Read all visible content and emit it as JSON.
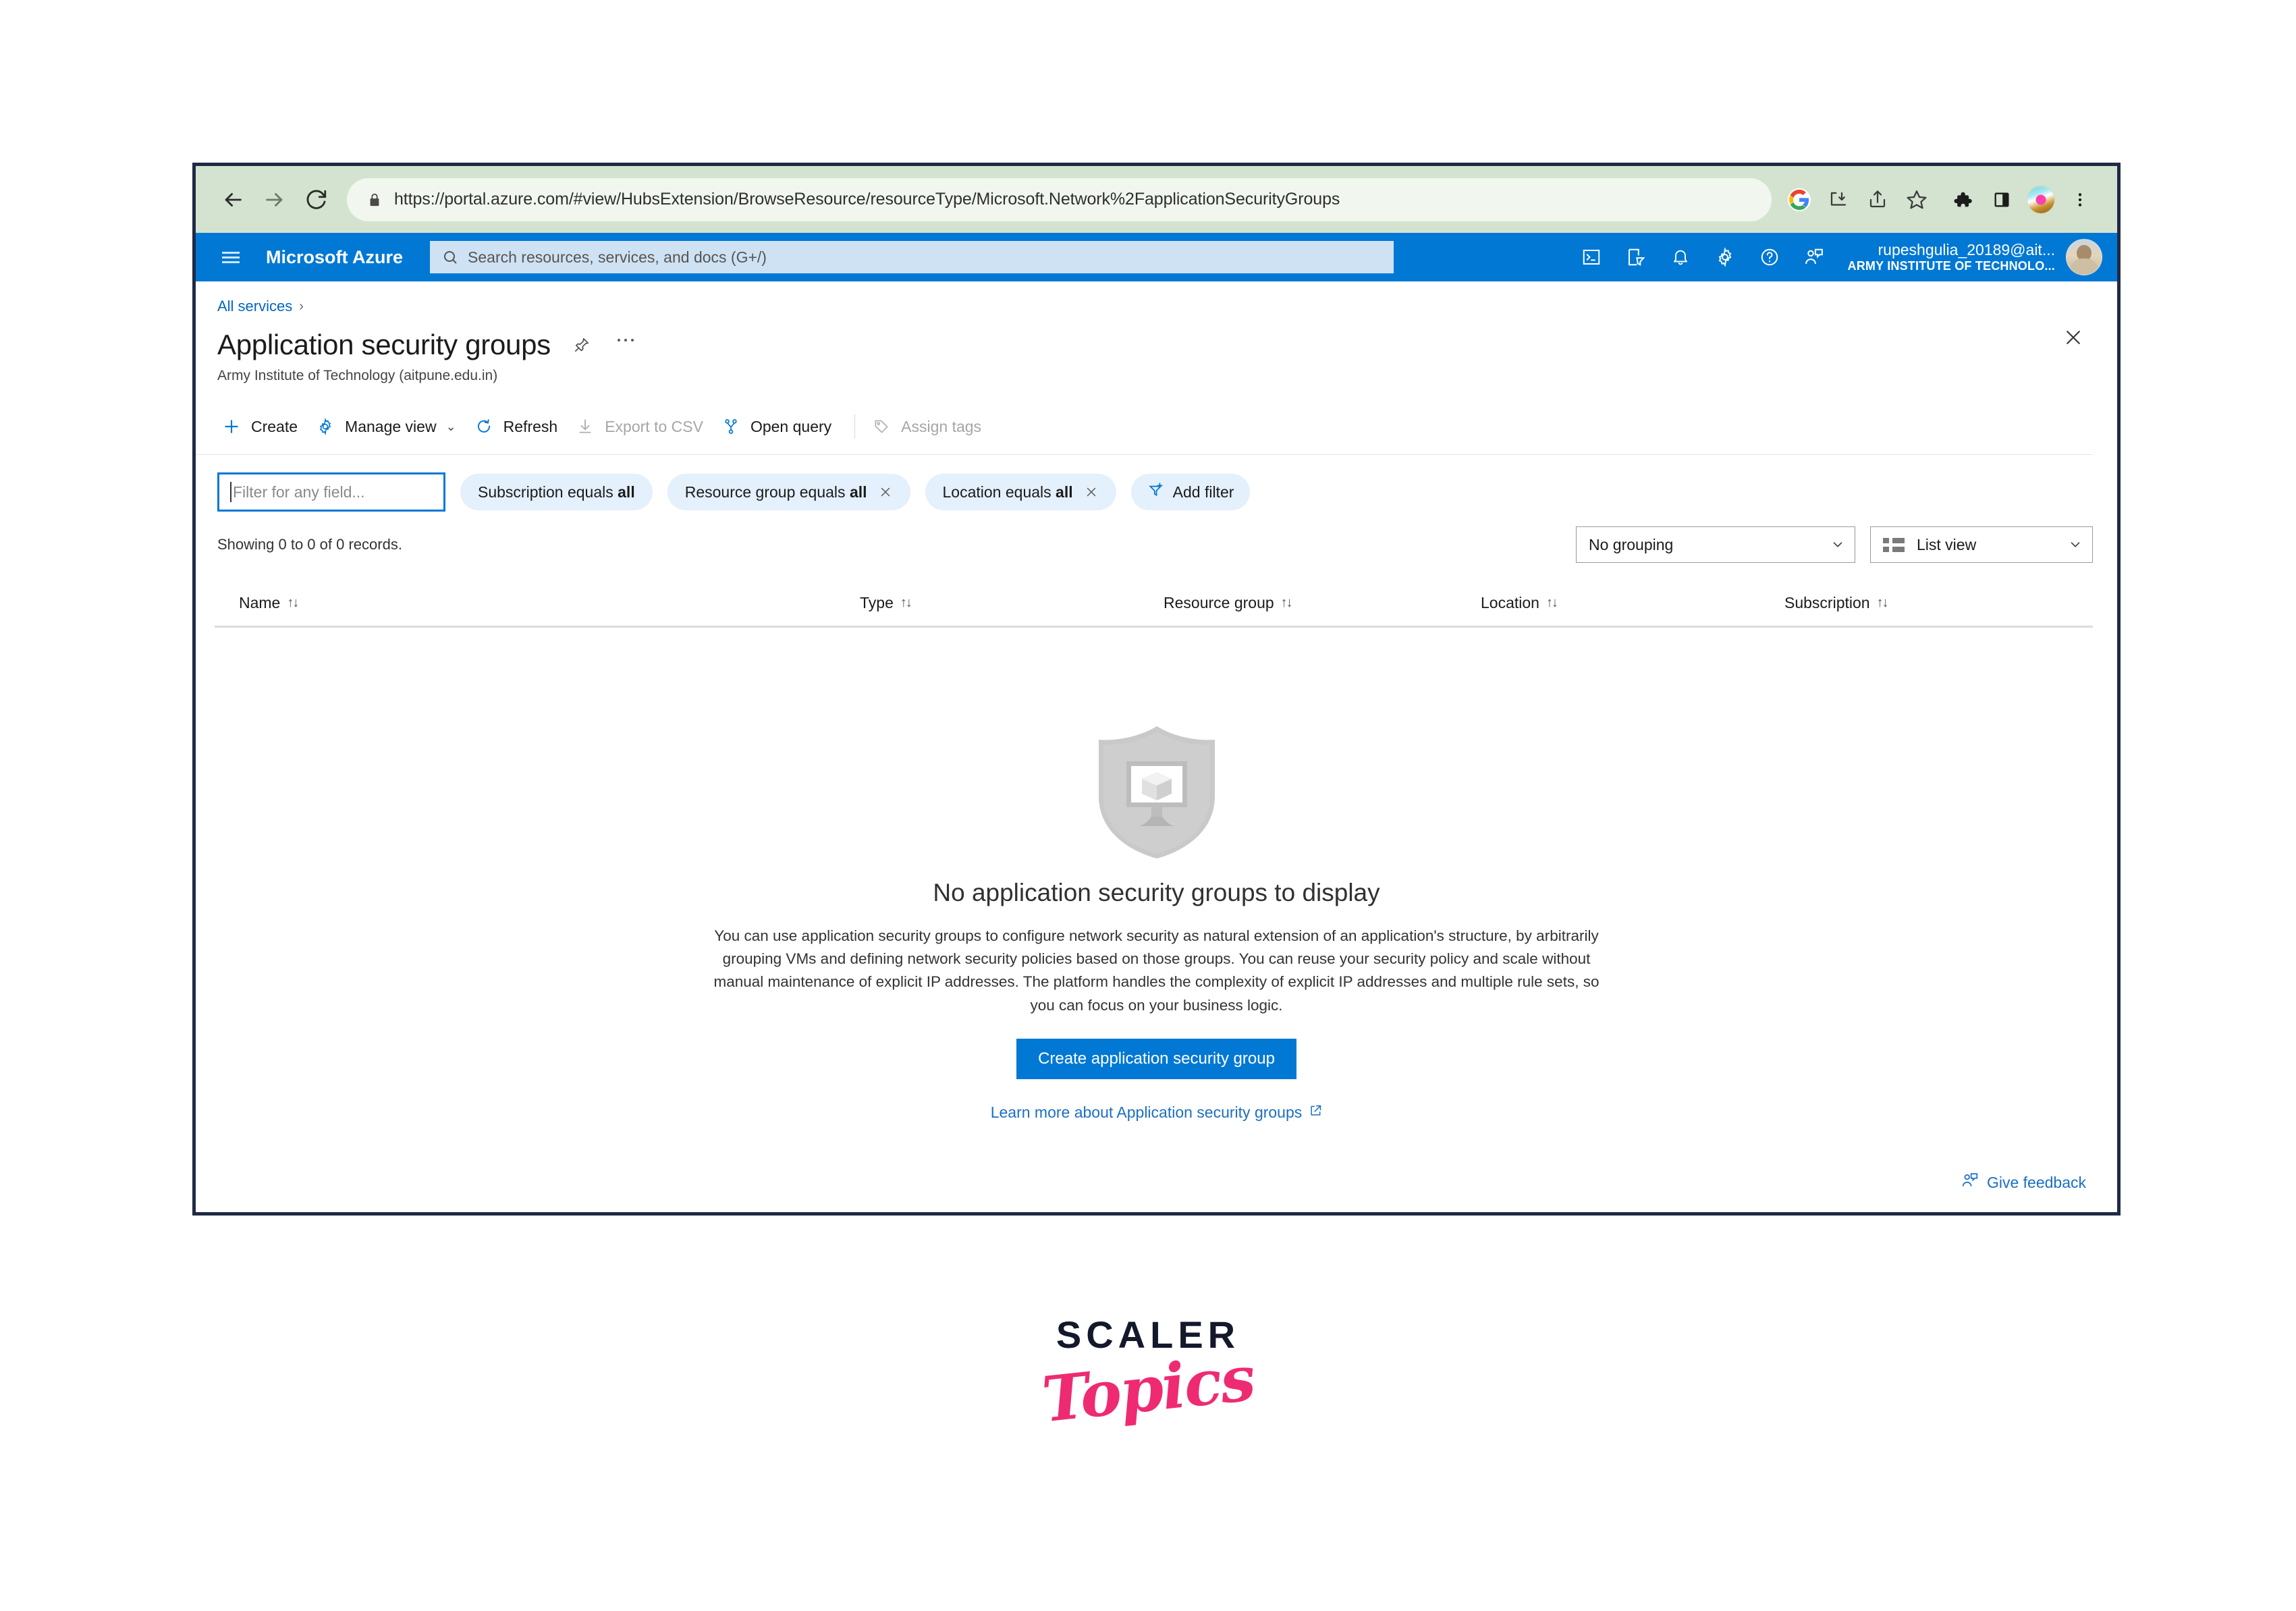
{
  "browser": {
    "back_icon": "arrow-left-icon",
    "forward_icon": "arrow-right-icon",
    "reload_icon": "reload-icon",
    "lock_icon": "lock-icon",
    "url": "https://portal.azure.com/#view/HubsExtension/BrowseResource/resourceType/Microsoft.Network%2FapplicationSecurityGroups",
    "url_domain": "portal.azure.com",
    "url_rest": "/#view/HubsExtension/BrowseResource/resourceType/Microsoft.Network%2FapplicationSecurityGroups",
    "url_scheme": "https://",
    "toolbar_color": "#d3e3cf",
    "right_icons": [
      "google-icon",
      "install-app-icon",
      "share-icon",
      "bookmark-star-icon",
      "extensions-puzzle-icon",
      "side-panel-icon",
      "profile-avatar-icon",
      "chrome-menu-icon"
    ]
  },
  "azure_bar": {
    "menu_icon": "hamburger-menu-icon",
    "brand": "Microsoft Azure",
    "search_icon": "search-icon",
    "search_placeholder": "Search resources, services, and docs (G+/)",
    "icons": [
      "cloud-shell-icon",
      "directories-subscriptions-icon",
      "notifications-bell-icon",
      "settings-gear-icon",
      "help-question-icon",
      "feedback-person-icon"
    ],
    "account_name": "rupeshgulia_20189@ait...",
    "account_org": "ARMY INSTITUTE OF TECHNOLO...",
    "background": "#0078d4"
  },
  "blade": {
    "breadcrumb": "All services",
    "breadcrumb_chevron": "›",
    "title": "Application security groups",
    "subtitle": "Army Institute of Technology (aitpune.edu.in)",
    "pin_icon": "pin-icon",
    "more_icon": "ellipsis-icon",
    "close_icon": "close-icon"
  },
  "command_bar": {
    "items": [
      {
        "label": "Create",
        "icon": "plus-icon",
        "disabled": false,
        "caret": false
      },
      {
        "label": "Manage view",
        "icon": "gear-icon",
        "disabled": false,
        "caret": true
      },
      {
        "label": "Refresh",
        "icon": "refresh-icon",
        "disabled": false,
        "caret": false
      },
      {
        "label": "Export to CSV",
        "icon": "download-icon",
        "disabled": true,
        "caret": false
      },
      {
        "label": "Open query",
        "icon": "query-icon",
        "disabled": false,
        "caret": false
      },
      {
        "label": "Assign tags",
        "icon": "tag-icon",
        "disabled": true,
        "caret": false
      }
    ],
    "caret_glyph": "⌄"
  },
  "filters": {
    "search_placeholder": "Filter for any field...",
    "search_value": "",
    "chips": [
      {
        "field": "Subscription",
        "operator": "equals",
        "value": "all",
        "removable": false
      },
      {
        "field": "Resource group",
        "operator": "equals",
        "value": "all",
        "removable": true
      },
      {
        "field": "Location",
        "operator": "equals",
        "value": "all",
        "removable": true
      }
    ],
    "add_filter_label": "Add filter",
    "add_filter_icon": "add-filter-icon",
    "remove_glyph": "✕"
  },
  "toolbar_row": {
    "records_text": "Showing 0 to 0 of 0 records.",
    "grouping_value": "No grouping",
    "view_value": "List view",
    "view_icon": "list-view-icon",
    "caret_glyph": "⌄"
  },
  "table": {
    "columns": [
      {
        "label": "Name",
        "sort": "↑↓"
      },
      {
        "label": "Type",
        "sort": "↑↓"
      },
      {
        "label": "Resource group",
        "sort": "↑↓"
      },
      {
        "label": "Location",
        "sort": "↑↓"
      },
      {
        "label": "Subscription",
        "sort": "↑↓"
      }
    ],
    "rows": []
  },
  "empty_state": {
    "illustration": "shield-with-monitor-icon",
    "title": "No application security groups to display",
    "description": "You can use application security groups to configure network security as natural extension of an application's structure, by arbitrarily grouping VMs and defining network security policies based on those groups. You can reuse your security policy and scale without manual maintenance of explicit IP addresses. The platform handles the complexity of explicit IP addresses and multiple rule sets, so you can focus on your business logic.",
    "cta_label": "Create application security group",
    "cta_color": "#0078d4",
    "learn_more_label": "Learn more about Application security groups",
    "learn_more_icon": "external-link-icon"
  },
  "feedback": {
    "label": "Give feedback",
    "icon": "feedback-person-icon"
  },
  "watermark": {
    "line1": "SCALER",
    "line2": "Topics",
    "color1": "#13182b",
    "color2": "#ee2b72"
  }
}
